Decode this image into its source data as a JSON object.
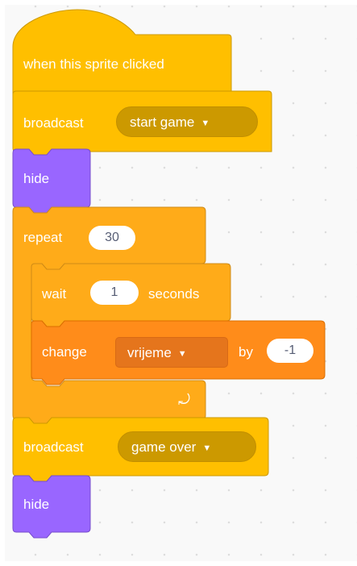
{
  "script": {
    "hat_block": {
      "label": "when this sprite clicked"
    },
    "broadcast_1": {
      "label": "broadcast",
      "message": "start game"
    },
    "hide_1": {
      "label": "hide"
    },
    "repeat": {
      "label": "repeat",
      "count": "30"
    },
    "wait": {
      "label": "wait",
      "value": "1",
      "unit": "seconds"
    },
    "change": {
      "label": "change",
      "variable": "vrijeme",
      "by_label": "by",
      "value": "-1"
    },
    "loop_arrow": "⤾",
    "broadcast_2": {
      "label": "broadcast",
      "message": "game over"
    },
    "hide_2": {
      "label": "hide"
    },
    "dropdown_caret": "▼"
  },
  "colors": {
    "events": "#ffbf00",
    "events_stroke": "#cc9900",
    "looks": "#9966ff",
    "looks_stroke": "#774dcb",
    "control": "#ffab19",
    "control_stroke": "#cf8b17",
    "variables": "#ff8c1a",
    "variables_stroke": "#db6e00",
    "canvas": "#f9f9f9"
  }
}
